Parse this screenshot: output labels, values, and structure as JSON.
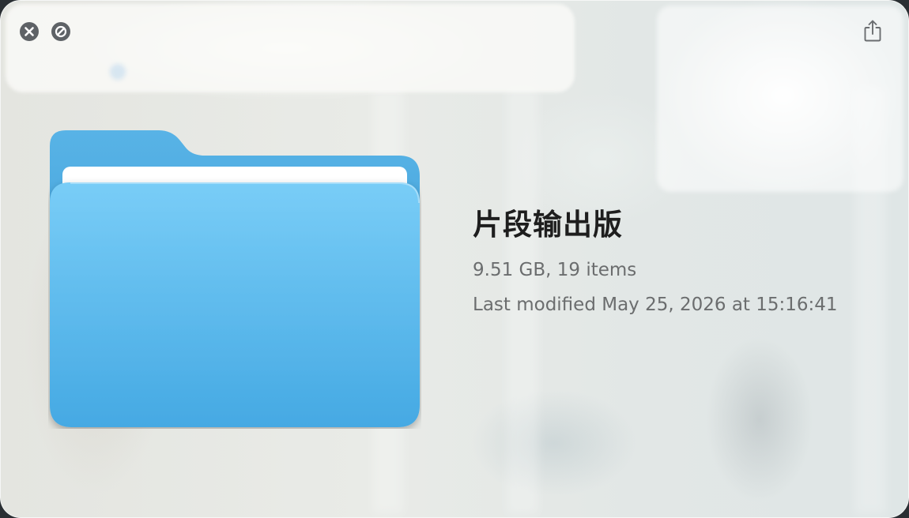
{
  "window": {
    "controls": {
      "close_icon": "close-icon",
      "fullscreen_icon": "slash-circle-icon",
      "share_icon": "share-icon"
    }
  },
  "file": {
    "icon": "folder-icon",
    "name": "片段输出版",
    "size_and_count": "9.51 GB, 19 items",
    "last_modified": "Last modified May 25, 2026 at 15:16:41"
  },
  "colors": {
    "folder_back": "#4aa8e0",
    "folder_front": "#5cb8ee",
    "control_gray": "#5e6266",
    "title_text": "#1e1e1e",
    "meta_text": "#6b6d6e"
  }
}
